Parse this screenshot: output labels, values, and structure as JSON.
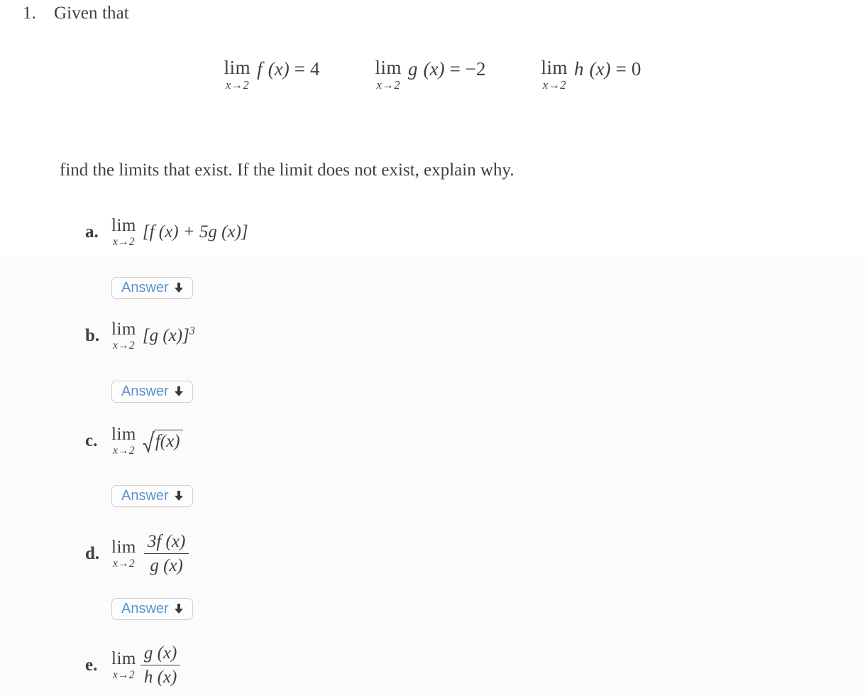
{
  "colors": {
    "text": "#3f3f3f",
    "answer_blue": "#5d93c8",
    "button_border": "#cfcfcf",
    "button_bg": "#fdfdfd",
    "page_bg": "#ffffff",
    "page_tint": "#fbfbfc",
    "arrow": "#3a3a3a"
  },
  "problem": {
    "number": "1.",
    "stem": "Given that",
    "instruction": "find the limits that exist. If the limit does not exist, explain why."
  },
  "given": [
    {
      "lim_op": "lim",
      "lim_sub": "x→2",
      "func": "f",
      "arg": "(x)",
      "relation": "=",
      "value": "4"
    },
    {
      "lim_op": "lim",
      "lim_sub": "x→2",
      "func": "g",
      "arg": "(x)",
      "relation": "=",
      "value": "−2"
    },
    {
      "lim_op": "lim",
      "lim_sub": "x→2",
      "func": "h",
      "arg": "(x)",
      "relation": "=",
      "value": "0"
    }
  ],
  "parts": [
    {
      "letter": "a.",
      "lim_op": "lim",
      "lim_sub": "x→2",
      "kind": "bracket",
      "body": "[f (x) + 5g (x)]",
      "has_answer": true,
      "answer_label": "Answer",
      "answer_icon": "down-arrow-icon"
    },
    {
      "letter": "b.",
      "lim_op": "lim",
      "lim_sub": "x→2",
      "kind": "power",
      "body": "[g (x)]",
      "exponent": "3",
      "has_answer": true,
      "answer_label": "Answer",
      "answer_icon": "down-arrow-icon"
    },
    {
      "letter": "c.",
      "lim_op": "lim",
      "lim_sub": "x→2",
      "kind": "radical",
      "radicand": "f(x)",
      "has_answer": true,
      "answer_label": "Answer",
      "answer_icon": "down-arrow-icon"
    },
    {
      "letter": "d.",
      "lim_op": "lim",
      "lim_sub": "x→2",
      "kind": "fraction",
      "numerator": "3f (x)",
      "denominator": "g (x)",
      "has_answer": true,
      "answer_label": "Answer",
      "answer_icon": "down-arrow-icon"
    },
    {
      "letter": "e.",
      "lim_op": "lim",
      "lim_sub": "x→2",
      "kind": "fraction",
      "numerator": "g (x)",
      "denominator": "h (x)",
      "has_answer": false
    }
  ]
}
